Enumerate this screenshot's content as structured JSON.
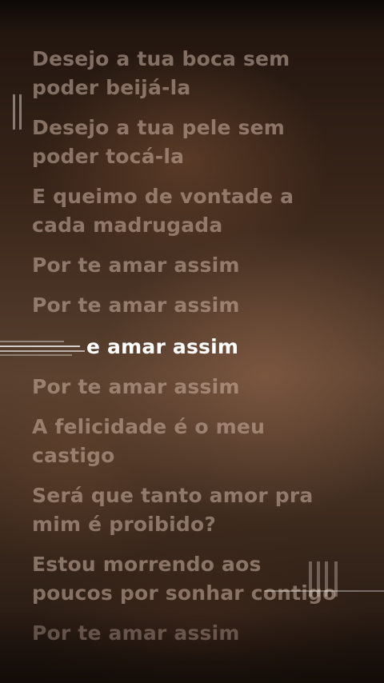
{
  "lyrics": {
    "lines": [
      "Desejo a tua boca sem",
      "poder beijá-la",
      "Desejo a tua pele sem",
      "poder tocá-la",
      "E queimo de vontade a",
      "cada madrugada",
      "Por te amar assim",
      "Por te amar assim",
      "e amar assim",
      "Por te amar assim",
      "A felicidade é o meu",
      "castigo",
      "Será que tanto amor pra",
      "mim é proibido?",
      "Estou morrendo aos",
      "poucos por sonhar contigo",
      "Por te amar assim"
    ]
  },
  "colors": {
    "active_line": "#ffffff",
    "inactive_line": "#cdb4a5",
    "background": "#2a1a12"
  }
}
